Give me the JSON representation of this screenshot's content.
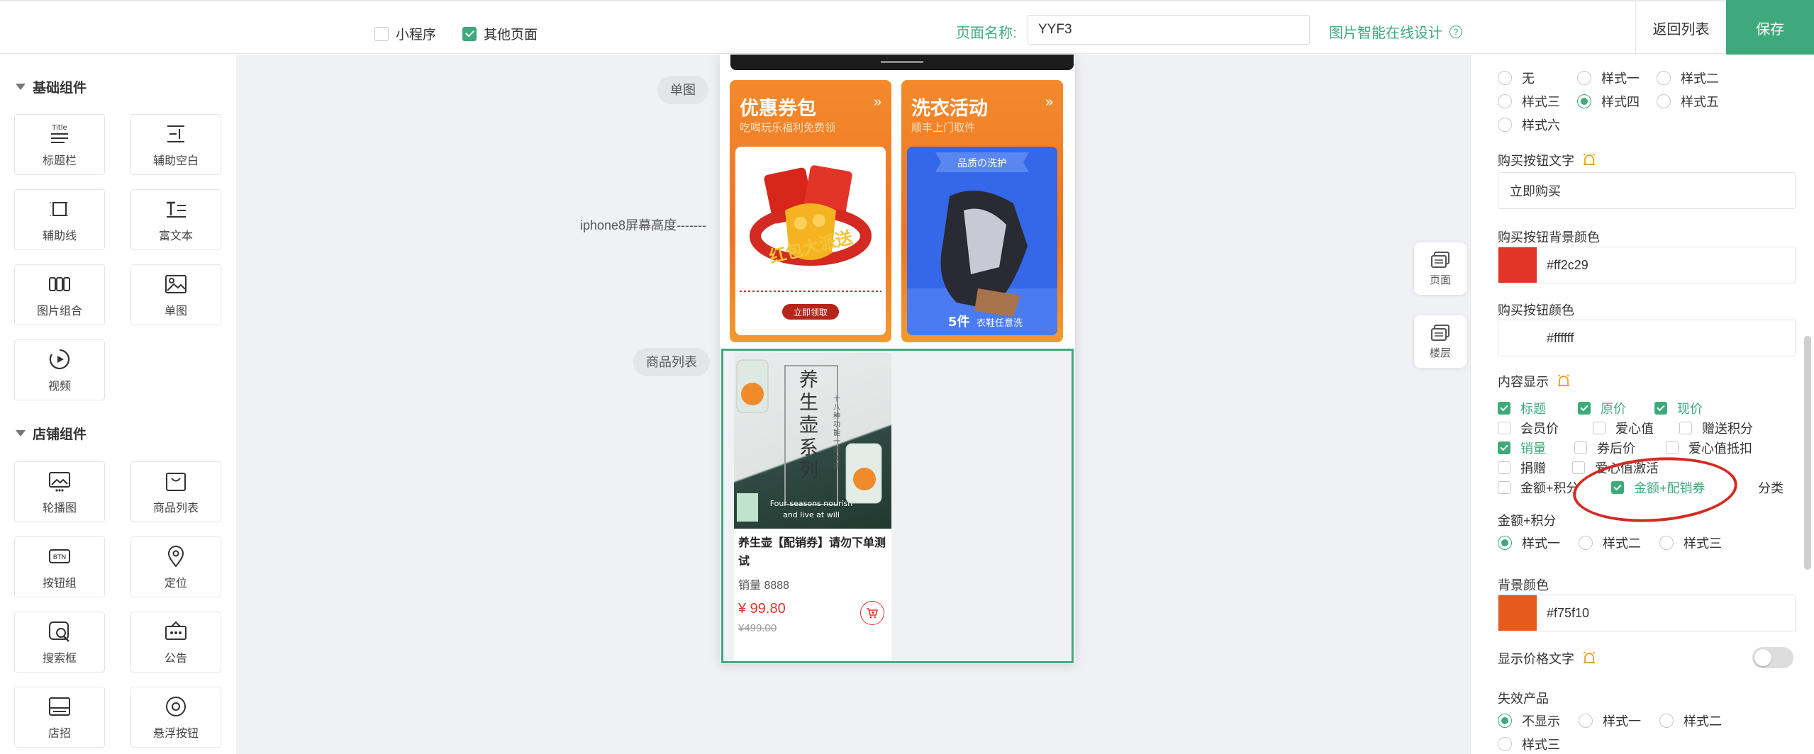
{
  "topbar": {
    "mini_program": "小程序",
    "other_pages": "其他页面",
    "page_name_label": "页面名称:",
    "page_name_value": "YYF3",
    "design_link": "图片智能在线设计",
    "back": "返回列表",
    "save": "保存"
  },
  "left_panel": {
    "basic_title": "基础组件",
    "basic": [
      "标题栏",
      "辅助空白",
      "辅助线",
      "富文本",
      "图片组合",
      "单图",
      "视频"
    ],
    "shop_title": "店铺组件",
    "shop": [
      "轮播图",
      "商品列表",
      "按钮组",
      "定位",
      "搜索框",
      "公告",
      "店招",
      "悬浮按钮"
    ],
    "title_icon_text": "Title",
    "btn_icon_text": "BTN"
  },
  "canvas": {
    "label_single_image": "单图",
    "label_iphone": "iphone8屏幕高度-------",
    "label_goods_list": "商品列表",
    "coupon": {
      "title": "优惠券包",
      "sub": "吃喝玩乐福利免费领",
      "arrow": "»",
      "btn": "立即领取",
      "art": "红包大派送"
    },
    "laundry": {
      "title": "洗衣活动",
      "sub": "顺丰上门取件",
      "arrow": "»",
      "tag": "品质の洗护",
      "promo_num": "5件",
      "promo": "衣鞋任意洗"
    },
    "product": {
      "image_title": "养生壶系列",
      "image_side": "十八种功能 一壶找养",
      "image_en1": "Four seasons nourish",
      "image_en2": "and live at will",
      "name": "养生壶【配销券】请勿下单测试",
      "sales": "销量 8888",
      "price": "¥ 99.80",
      "orig_price": "¥499.00"
    },
    "float_page": "页面",
    "float_floor": "楼层"
  },
  "right_panel": {
    "style_row1": [
      "无",
      "样式一",
      "样式二"
    ],
    "style_row2": [
      "样式三",
      "样式四",
      "样式五"
    ],
    "style_row3": [
      "样式六"
    ],
    "buy_text_label": "购买按钮文字",
    "buy_text_value": "立即购买",
    "buy_bg_label": "购买按钮背景颜色",
    "buy_bg_value": "#ff2c29",
    "buy_color_label": "购买按钮颜色",
    "buy_color_value": "#ffffff",
    "content_label": "内容显示",
    "content": {
      "title": "标题",
      "orig": "原价",
      "now": "现价",
      "member": "会员价",
      "love": "爱心值",
      "gift_points": "赠送积分",
      "sales": "销量",
      "coupon_after": "券后价",
      "love_deduct": "爱心值抵扣",
      "donate": "捐赠",
      "love_activate": "爱心值激活",
      "amount_points": "金额+积分",
      "amount_coupon": "金额+配销券",
      "category": "分类"
    },
    "amount_points_label": "金额+积分",
    "amount_styles": [
      "样式一",
      "样式二",
      "样式三"
    ],
    "bg_color_label": "背景颜色",
    "bg_color_value": "#f75f10",
    "price_text_label": "显示价格文字",
    "invalid_label": "失效产品",
    "invalid_opts": [
      "不显示",
      "样式一",
      "样式二"
    ],
    "invalid_cut": "样式三"
  },
  "colors": {
    "accent": "#3eaa7c",
    "buy_bg": "#ff2c29",
    "bg": "#f75f10",
    "highlight": "#d42a22"
  }
}
